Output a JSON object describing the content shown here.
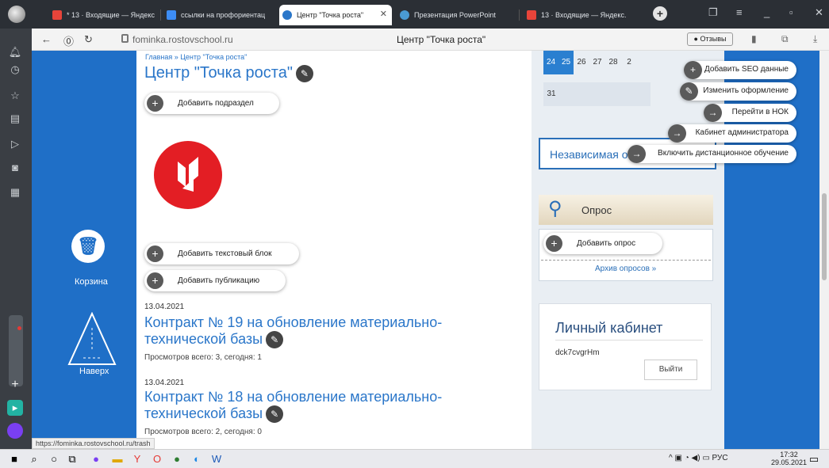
{
  "tabs": [
    {
      "label": "* 13 · Входящие — Яндекс",
      "icon": "mail-icon",
      "active": false
    },
    {
      "label": "ссылки на профориентац",
      "icon": "doc-icon",
      "active": false
    },
    {
      "label": "Центр \"Точка роста\"",
      "icon": "site-icon",
      "active": true
    },
    {
      "label": "Презентация PowerPoint",
      "icon": "powerpoint-icon",
      "active": false
    },
    {
      "label": "13 · Входящие — Яндекс.",
      "icon": "mail-icon",
      "active": false
    }
  ],
  "address": {
    "url": "fominka.rostovschool.ru",
    "title": "Центр \"Точка роста\"",
    "reviews": "Отзывы"
  },
  "page": {
    "breadcrumb": "Главная » Центр \"Точка роста\"",
    "title": "Центр \"Точка роста\"",
    "add_subsection": "Добавить подраздел",
    "add_text_block": "Добавить текстовый блок",
    "add_publication": "Добавить публикацию"
  },
  "posts": [
    {
      "date": "13.04.2021",
      "title": "Контракт № 19 на обновление материально-технической базы",
      "views": "Просмотров всего: 3, сегодня: 1"
    },
    {
      "date": "13.04.2021",
      "title": "Контракт № 18 на обновление материально-технической базы",
      "views": "Просмотров всего: 2, сегодня: 0"
    }
  ],
  "left_widgets": {
    "trash_label": "Корзина",
    "up_label": "Наверх"
  },
  "calendar": {
    "row1": [
      "24",
      "25",
      "26",
      "27",
      "28",
      "2"
    ],
    "row2": [
      "31"
    ]
  },
  "sidebar": {
    "independent": "Независимая о",
    "poll_title": "Опрос",
    "add_poll": "Добавить опрос",
    "archive": "Архив опросов »",
    "cabinet_title": "Личный кабинет",
    "username": "dck7cvgrHm",
    "logout": "Выйти"
  },
  "admin_menu": [
    {
      "label": "Добавить SEO данные",
      "icon": "plus-icon"
    },
    {
      "label": "Изменить оформление",
      "icon": "pencil-icon"
    },
    {
      "label": "Перейти в НОК",
      "icon": "arrow-right-icon"
    },
    {
      "label": "Кабинет администратора",
      "icon": "arrow-right-icon"
    },
    {
      "label": "Включить дистанционное обучение",
      "icon": "arrow-right-icon"
    }
  ],
  "status_link": "https://fominka.rostovschool.ru/trash",
  "tray": {
    "lang": "РУС",
    "time": "17:32",
    "date": "29.05.2021"
  },
  "colors": {
    "page_blue": "#1f6fc7",
    "link_blue": "#2a76c9",
    "logo_red": "#e31e24"
  }
}
